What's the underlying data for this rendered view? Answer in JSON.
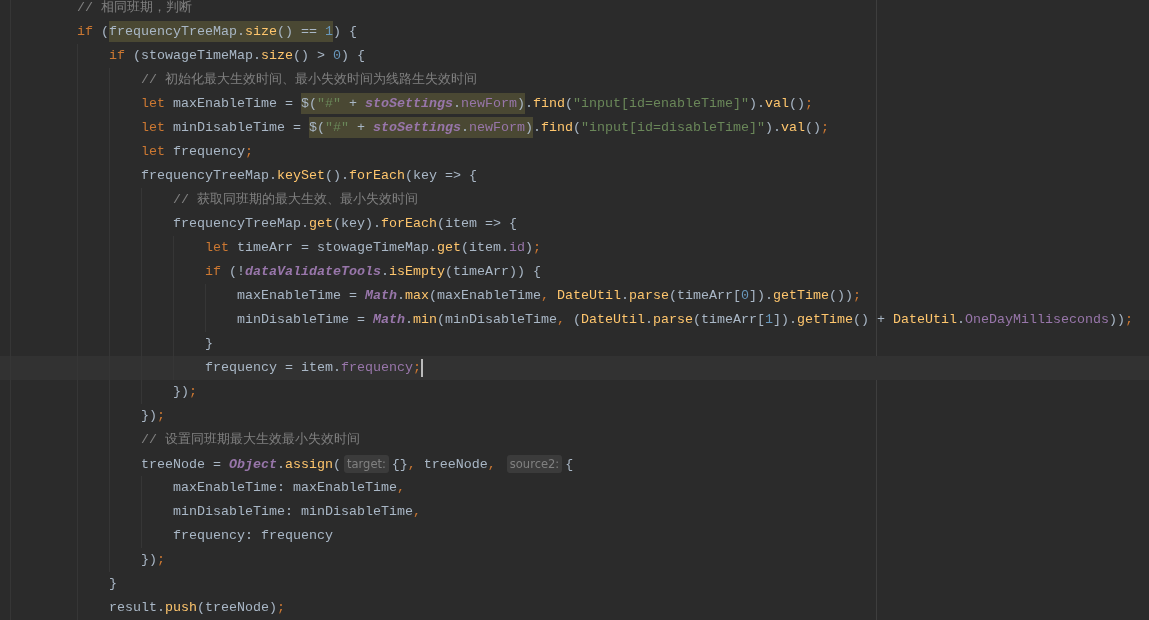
{
  "editor": {
    "lines": [
      {
        "current": false,
        "segments": [
          {
            "kind": "code",
            "text": "// 相同班期，判断"
          }
        ]
      },
      {
        "current": false,
        "segments": [
          {
            "kind": "code",
            "text": "if ("
          },
          {
            "kind": "usage",
            "text": "frequencyTreeMap.size() == 1"
          },
          {
            "kind": "code",
            "text": ") {"
          }
        ],
        "children": [
          {
            "current": false,
            "segments": [
              {
                "kind": "code",
                "text": "if (stowageTimeMap.size() > 0) {"
              }
            ],
            "children": [
              {
                "current": false,
                "segments": [
                  {
                    "kind": "code",
                    "text": "// 初始化最大生效时间、最小失效时间为线路生失效时间"
                  }
                ]
              },
              {
                "current": false,
                "segments": [
                  {
                    "kind": "code",
                    "text": "let maxEnableTime = "
                  },
                  {
                    "kind": "usage",
                    "text": "$(\"#\" + **stoSettings**.newForm)"
                  },
                  {
                    "kind": "code",
                    "text": ".find(\"input[id=enableTime]\").val();"
                  }
                ]
              },
              {
                "current": false,
                "segments": [
                  {
                    "kind": "code",
                    "text": "let minDisableTime = "
                  },
                  {
                    "kind": "usage",
                    "text": "$(\"#\" + **stoSettings**.newForm)"
                  },
                  {
                    "kind": "code",
                    "text": ".find(\"input[id=disableTime]\").val();"
                  }
                ]
              },
              {
                "current": false,
                "segments": [
                  {
                    "kind": "code",
                    "text": "let frequency;"
                  }
                ]
              },
              {
                "current": false,
                "segments": [
                  {
                    "kind": "code",
                    "text": "frequencyTreeMap.keySet().forEach(key => {"
                  }
                ],
                "children": [
                  {
                    "current": false,
                    "segments": [
                      {
                        "kind": "code",
                        "text": "// 获取同班期的最大生效、最小失效时间"
                      }
                    ]
                  },
                  {
                    "current": false,
                    "segments": [
                      {
                        "kind": "code",
                        "text": "frequencyTreeMap.get(key).forEach(item => {"
                      }
                    ],
                    "children": [
                      {
                        "current": false,
                        "segments": [
                          {
                            "kind": "code",
                            "text": "let timeArr = stowageTimeMap.get(item.id);"
                          }
                        ]
                      },
                      {
                        "current": false,
                        "segments": [
                          {
                            "kind": "code",
                            "text": "if (!**dataValidateTools**.isEmpty(timeArr)) {"
                          }
                        ],
                        "children": [
                          {
                            "current": false,
                            "segments": [
                              {
                                "kind": "code",
                                "text": "maxEnableTime = **Math**.max(maxEnableTime, DateUtil.parse(timeArr[0]).getTime());"
                              }
                            ]
                          },
                          {
                            "current": false,
                            "segments": [
                              {
                                "kind": "code",
                                "text": "minDisableTime = **Math**.min(minDisableTime, (DateUtil.parse(timeArr[1]).getTime() + DateUtil.OneDayMilliseconds));"
                              }
                            ]
                          }
                        ]
                      },
                      {
                        "current": false,
                        "segments": [
                          {
                            "kind": "code",
                            "text": "}"
                          }
                        ]
                      },
                      {
                        "current": true,
                        "segments": [
                          {
                            "kind": "code",
                            "text": "frequency = item.frequency;"
                          }
                        ]
                      }
                    ]
                  },
                  {
                    "current": false,
                    "segments": [
                      {
                        "kind": "code",
                        "text": "});"
                      }
                    ]
                  }
                ]
              },
              {
                "current": false,
                "segments": [
                  {
                    "kind": "code",
                    "text": "});"
                  }
                ]
              },
              {
                "current": false,
                "segments": [
                  {
                    "kind": "code",
                    "text": "// 设置同班期最大生效最小失效时间"
                  }
                ]
              },
              {
                "current": false,
                "segments": [
                  {
                    "kind": "code",
                    "text": "treeNode = **Object**.assign("
                  },
                  {
                    "kind": "hint",
                    "text": "target:"
                  },
                  {
                    "kind": "code",
                    "text": "{}, treeNode, "
                  },
                  {
                    "kind": "hint",
                    "text": "source2:"
                  },
                  {
                    "kind": "code",
                    "text": "{"
                  }
                ],
                "children": [
                  {
                    "current": false,
                    "segments": [
                      {
                        "kind": "code",
                        "text": "maxEnableTime: maxEnableTime,"
                      }
                    ]
                  },
                  {
                    "current": false,
                    "segments": [
                      {
                        "kind": "code",
                        "text": "minDisableTime: minDisableTime,"
                      }
                    ]
                  },
                  {
                    "current": false,
                    "segments": [
                      {
                        "kind": "code",
                        "text": "frequency: frequency"
                      }
                    ]
                  }
                ]
              },
              {
                "current": false,
                "segments": [
                  {
                    "kind": "code",
                    "text": "});"
                  }
                ]
              }
            ]
          },
          {
            "current": false,
            "segments": [
              {
                "kind": "code",
                "text": "}"
              }
            ]
          },
          {
            "current": false,
            "segments": [
              {
                "kind": "code",
                "text": "result.push(treeNode);"
              }
            ]
          }
        ]
      }
    ]
  }
}
